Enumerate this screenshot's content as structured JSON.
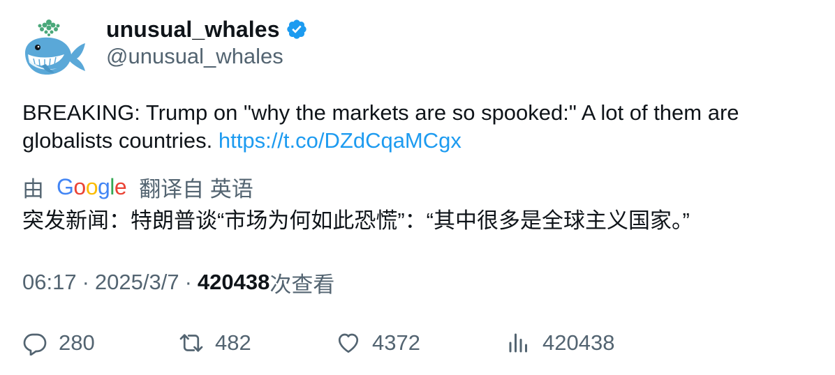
{
  "author": {
    "display_name": "unusual_whales",
    "handle": "@unusual_whales",
    "verified": true,
    "verified_icon": "verified-badge-icon",
    "avatar_icon": "whale-avatar"
  },
  "tweet": {
    "text": "BREAKING: Trump on \"why the markets are so spooked:\" A lot of them are globalists countries. ",
    "link": "https://t.co/DZdCqaMCgx"
  },
  "translation": {
    "prefix": "由",
    "provider": "Google",
    "suffix": "翻译自 英语",
    "text": "突发新闻：特朗普谈“市场为何如此恐慌”：“其中很多是全球主义国家。”"
  },
  "meta": {
    "time": "06:17",
    "separator": "·",
    "date": "2025/3/7",
    "views_count": "420438",
    "views_label": "次查看"
  },
  "actions": {
    "reply_count": "280",
    "retweet_count": "482",
    "like_count": "4372",
    "views_count": "420438"
  },
  "colors": {
    "text_primary": "#0f1419",
    "text_secondary": "#536471",
    "link": "#1d9bf0",
    "verified": "#1d9bf0"
  }
}
